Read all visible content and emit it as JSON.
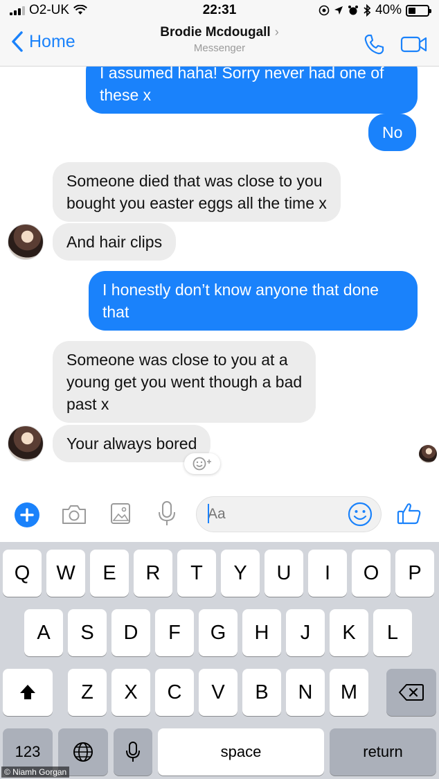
{
  "status_bar": {
    "carrier": "O2-UK",
    "time": "22:31",
    "battery": "40%",
    "battery_level": 0.4
  },
  "nav": {
    "back_label": "Home",
    "contact_name": "Brodie Mcdougall",
    "subtitle": "Messenger"
  },
  "messages": [
    {
      "from": "me",
      "text": "I assumed haha! Sorry never had one of\nthese x"
    },
    {
      "from": "me",
      "text": "No"
    },
    {
      "from": "them",
      "text": "Someone died that was close to you\nbought you easter eggs all the time x"
    },
    {
      "from": "them",
      "text": "And hair clips"
    },
    {
      "from": "me",
      "text": "I honestly don’t know anyone that done\nthat"
    },
    {
      "from": "them",
      "text": "Someone was close to you at a\nyoung get you went though a bad\npast x"
    },
    {
      "from": "them",
      "text": "Your always bored"
    }
  ],
  "composer": {
    "placeholder": "Aa"
  },
  "keyboard": {
    "row1": [
      "Q",
      "W",
      "E",
      "R",
      "T",
      "Y",
      "U",
      "I",
      "O",
      "P"
    ],
    "row2": [
      "A",
      "S",
      "D",
      "F",
      "G",
      "H",
      "J",
      "K",
      "L"
    ],
    "row3": [
      "Z",
      "X",
      "C",
      "V",
      "B",
      "N",
      "M"
    ],
    "numbers_label": "123",
    "space_label": "space",
    "return_label": "return"
  },
  "watermark": "© Niamh Gorgan",
  "colors": {
    "accent": "#1a82fb",
    "incoming_bubble": "#ececec",
    "keyboard_bg": "#d2d5db"
  },
  "icons": [
    "wifi-icon",
    "location-icon",
    "alarm-icon",
    "bluetooth-icon",
    "phone-icon",
    "video-icon",
    "plus-icon",
    "camera-icon",
    "image-icon",
    "microphone-icon",
    "emoji-icon",
    "like-icon",
    "globe-icon",
    "shift-icon",
    "backspace-icon"
  ]
}
